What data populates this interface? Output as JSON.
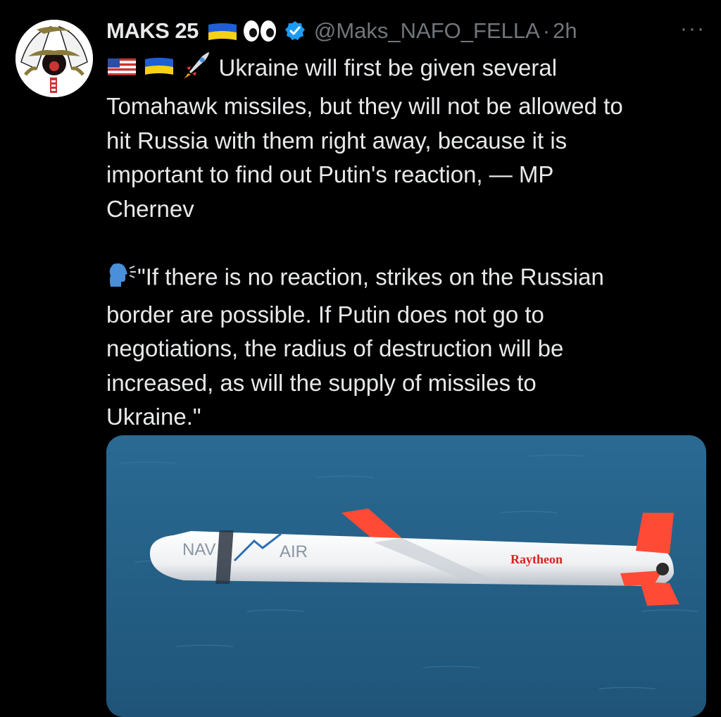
{
  "tweet": {
    "display_name": "MAKS 25",
    "handle": "@Maks_NAFO_FELLA",
    "separator": "·",
    "time": "2h",
    "more": "···",
    "text_line1": "Ukraine will first be given several",
    "text_rest": "Tomahawk missiles, but they will not be allowed to\nhit Russia with them right away, because it is\nimportant to find out Putin's reaction, — MP\nChernev",
    "quote_line1": "\"If there is no reaction, strikes on the Russian",
    "quote_rest": "border are possible. If Putin does not go to\nnegotiations, the radius of destruction will be\nincreased, as will the supply of missiles to\nUkraine.\""
  },
  "media": {
    "missile_label_navair_left": "NAV",
    "missile_label_navair_right": "AIR",
    "missile_label_brand": "Raytheon"
  },
  "icons": [
    "avatar",
    "ukraine-flag-icon",
    "eyes-icon",
    "verified-badge-icon",
    "more-icon",
    "us-flag-icon",
    "rocket-icon",
    "speaking-head-icon"
  ],
  "colors": {
    "background": "#000000",
    "text": "#e7e9ea",
    "secondary": "#71767b",
    "verified": "#1d9bf0",
    "sea": "#2a5f82",
    "fin": "#ff3b2a"
  }
}
